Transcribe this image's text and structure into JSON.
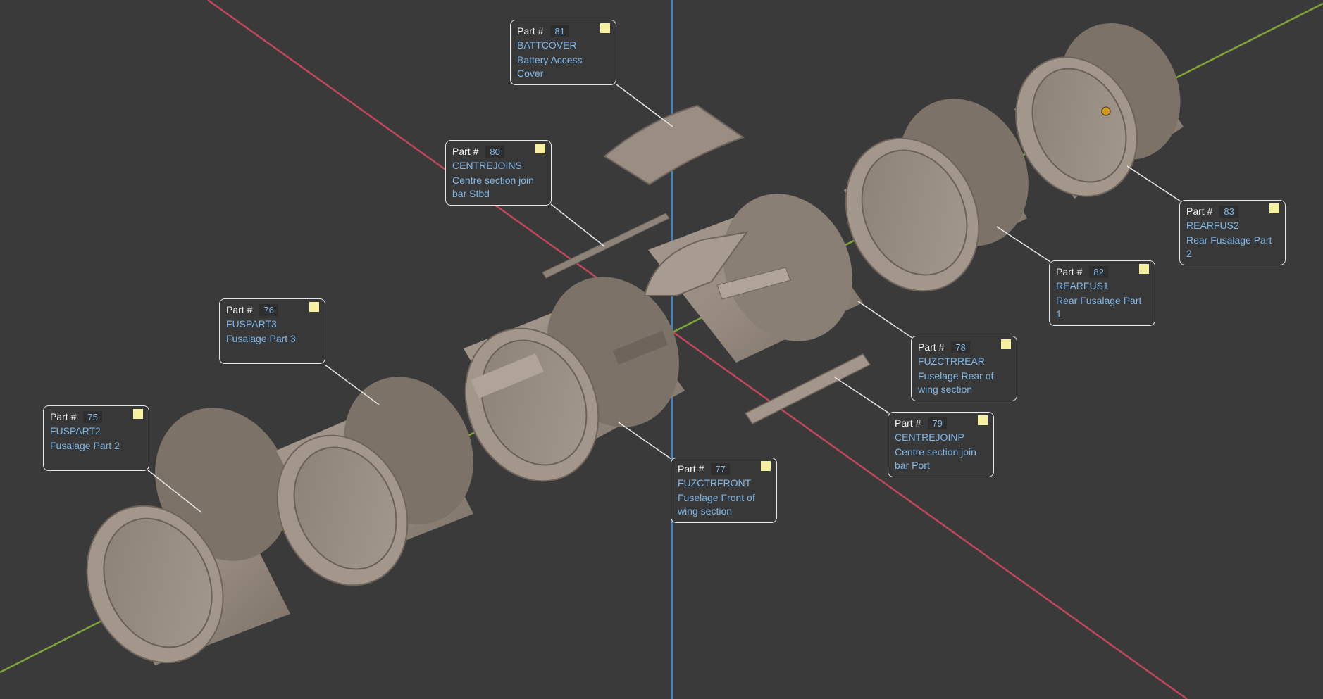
{
  "colors": {
    "background": "#3a3a3a",
    "axis_x": "#c0465a",
    "axis_y": "#7fa43a",
    "axis_z": "#3f86c8",
    "part": "#9b8f84",
    "label_text": "#7fb6e6",
    "label_border": "#e6e6e6",
    "note": "#f4f0a0",
    "pivot": "#d59a1a"
  },
  "labels": [
    {
      "id": "81",
      "part_label": "Part #",
      "number": "81",
      "code": "BATTCOVER",
      "desc": "Battery Access Cover"
    },
    {
      "id": "80",
      "part_label": "Part #",
      "number": "80",
      "code": "CENTREJOINS",
      "desc": "Centre section join bar Stbd"
    },
    {
      "id": "76",
      "part_label": "Part #",
      "number": "76",
      "code": "FUSPART3",
      "desc": "Fusalage Part 3"
    },
    {
      "id": "75",
      "part_label": "Part #",
      "number": "75",
      "code": "FUSPART2",
      "desc": "Fusalage Part 2"
    },
    {
      "id": "77",
      "part_label": "Part #",
      "number": "77",
      "code": "FUZCTRFRONT",
      "desc": "Fuselage Front of wing section"
    },
    {
      "id": "78",
      "part_label": "Part #",
      "number": "78",
      "code": "FUZCTRREAR",
      "desc": "Fuselage Rear of wing section"
    },
    {
      "id": "79",
      "part_label": "Part #",
      "number": "79",
      "code": "CENTREJOINP",
      "desc": "Centre section join bar Port"
    },
    {
      "id": "82",
      "part_label": "Part #",
      "number": "82",
      "code": "REARFUS1",
      "desc": "Rear Fusalage Part 1"
    },
    {
      "id": "83",
      "part_label": "Part #",
      "number": "83",
      "code": "REARFUS2",
      "desc": "Rear Fusalage Part 2"
    }
  ]
}
